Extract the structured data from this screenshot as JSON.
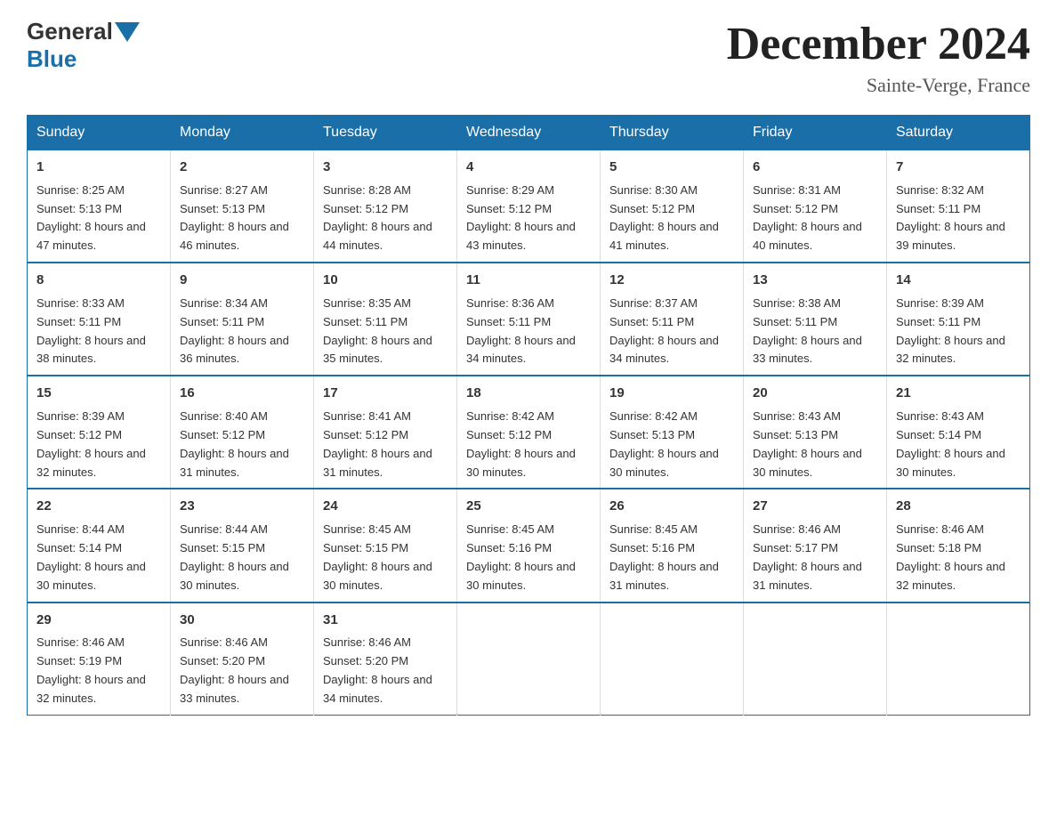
{
  "header": {
    "logo_general": "General",
    "logo_blue": "Blue",
    "main_title": "December 2024",
    "subtitle": "Sainte-Verge, France"
  },
  "days_of_week": [
    "Sunday",
    "Monday",
    "Tuesday",
    "Wednesday",
    "Thursday",
    "Friday",
    "Saturday"
  ],
  "weeks": [
    [
      {
        "day": "1",
        "sunrise": "8:25 AM",
        "sunset": "5:13 PM",
        "daylight": "8 hours and 47 minutes."
      },
      {
        "day": "2",
        "sunrise": "8:27 AM",
        "sunset": "5:13 PM",
        "daylight": "8 hours and 46 minutes."
      },
      {
        "day": "3",
        "sunrise": "8:28 AM",
        "sunset": "5:12 PM",
        "daylight": "8 hours and 44 minutes."
      },
      {
        "day": "4",
        "sunrise": "8:29 AM",
        "sunset": "5:12 PM",
        "daylight": "8 hours and 43 minutes."
      },
      {
        "day": "5",
        "sunrise": "8:30 AM",
        "sunset": "5:12 PM",
        "daylight": "8 hours and 41 minutes."
      },
      {
        "day": "6",
        "sunrise": "8:31 AM",
        "sunset": "5:12 PM",
        "daylight": "8 hours and 40 minutes."
      },
      {
        "day": "7",
        "sunrise": "8:32 AM",
        "sunset": "5:11 PM",
        "daylight": "8 hours and 39 minutes."
      }
    ],
    [
      {
        "day": "8",
        "sunrise": "8:33 AM",
        "sunset": "5:11 PM",
        "daylight": "8 hours and 38 minutes."
      },
      {
        "day": "9",
        "sunrise": "8:34 AM",
        "sunset": "5:11 PM",
        "daylight": "8 hours and 36 minutes."
      },
      {
        "day": "10",
        "sunrise": "8:35 AM",
        "sunset": "5:11 PM",
        "daylight": "8 hours and 35 minutes."
      },
      {
        "day": "11",
        "sunrise": "8:36 AM",
        "sunset": "5:11 PM",
        "daylight": "8 hours and 34 minutes."
      },
      {
        "day": "12",
        "sunrise": "8:37 AM",
        "sunset": "5:11 PM",
        "daylight": "8 hours and 34 minutes."
      },
      {
        "day": "13",
        "sunrise": "8:38 AM",
        "sunset": "5:11 PM",
        "daylight": "8 hours and 33 minutes."
      },
      {
        "day": "14",
        "sunrise": "8:39 AM",
        "sunset": "5:11 PM",
        "daylight": "8 hours and 32 minutes."
      }
    ],
    [
      {
        "day": "15",
        "sunrise": "8:39 AM",
        "sunset": "5:12 PM",
        "daylight": "8 hours and 32 minutes."
      },
      {
        "day": "16",
        "sunrise": "8:40 AM",
        "sunset": "5:12 PM",
        "daylight": "8 hours and 31 minutes."
      },
      {
        "day": "17",
        "sunrise": "8:41 AM",
        "sunset": "5:12 PM",
        "daylight": "8 hours and 31 minutes."
      },
      {
        "day": "18",
        "sunrise": "8:42 AM",
        "sunset": "5:12 PM",
        "daylight": "8 hours and 30 minutes."
      },
      {
        "day": "19",
        "sunrise": "8:42 AM",
        "sunset": "5:13 PM",
        "daylight": "8 hours and 30 minutes."
      },
      {
        "day": "20",
        "sunrise": "8:43 AM",
        "sunset": "5:13 PM",
        "daylight": "8 hours and 30 minutes."
      },
      {
        "day": "21",
        "sunrise": "8:43 AM",
        "sunset": "5:14 PM",
        "daylight": "8 hours and 30 minutes."
      }
    ],
    [
      {
        "day": "22",
        "sunrise": "8:44 AM",
        "sunset": "5:14 PM",
        "daylight": "8 hours and 30 minutes."
      },
      {
        "day": "23",
        "sunrise": "8:44 AM",
        "sunset": "5:15 PM",
        "daylight": "8 hours and 30 minutes."
      },
      {
        "day": "24",
        "sunrise": "8:45 AM",
        "sunset": "5:15 PM",
        "daylight": "8 hours and 30 minutes."
      },
      {
        "day": "25",
        "sunrise": "8:45 AM",
        "sunset": "5:16 PM",
        "daylight": "8 hours and 30 minutes."
      },
      {
        "day": "26",
        "sunrise": "8:45 AM",
        "sunset": "5:16 PM",
        "daylight": "8 hours and 31 minutes."
      },
      {
        "day": "27",
        "sunrise": "8:46 AM",
        "sunset": "5:17 PM",
        "daylight": "8 hours and 31 minutes."
      },
      {
        "day": "28",
        "sunrise": "8:46 AM",
        "sunset": "5:18 PM",
        "daylight": "8 hours and 32 minutes."
      }
    ],
    [
      {
        "day": "29",
        "sunrise": "8:46 AM",
        "sunset": "5:19 PM",
        "daylight": "8 hours and 32 minutes."
      },
      {
        "day": "30",
        "sunrise": "8:46 AM",
        "sunset": "5:20 PM",
        "daylight": "8 hours and 33 minutes."
      },
      {
        "day": "31",
        "sunrise": "8:46 AM",
        "sunset": "5:20 PM",
        "daylight": "8 hours and 34 minutes."
      },
      null,
      null,
      null,
      null
    ]
  ],
  "labels": {
    "sunrise": "Sunrise:",
    "sunset": "Sunset:",
    "daylight": "Daylight:"
  }
}
